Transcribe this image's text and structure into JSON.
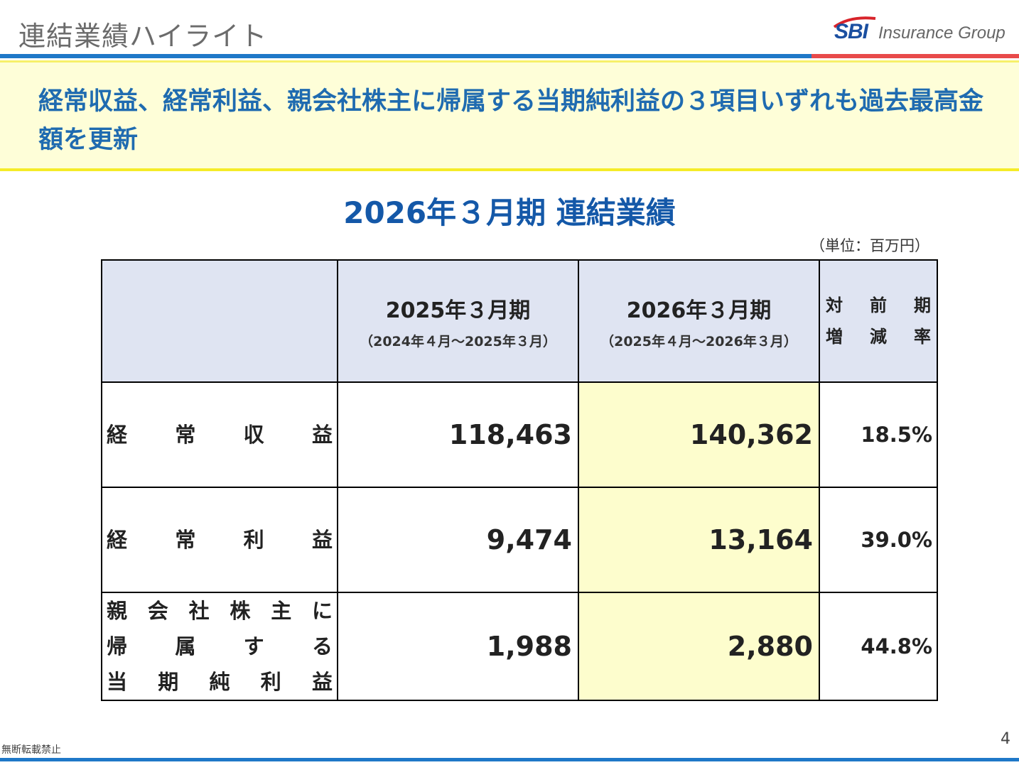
{
  "header": {
    "title": "連結業績ハイライト",
    "logo_brand": "SBI",
    "logo_group": "Insurance Group"
  },
  "banner": {
    "text": "経常収益、経常利益、親会社株主に帰属する当期純利益の３項目いずれも過去最高金額を更新"
  },
  "table": {
    "title": "2026年３月期 連結業績",
    "unit": "（単位：百万円）",
    "columns": [
      {
        "label": "2025年３月期",
        "sub": "（2024年４月～2025年３月）"
      },
      {
        "label": "2026年３月期",
        "sub": "（2025年４月～2026年３月）"
      }
    ],
    "change_header": [
      "対",
      "前",
      "期",
      "増",
      "減",
      "率"
    ],
    "rows": [
      {
        "label": [
          "経",
          "常",
          "収",
          "益"
        ],
        "prev": "118,463",
        "curr": "140,362",
        "change": "18.5%"
      },
      {
        "label": [
          "経",
          "常",
          "利",
          "益"
        ],
        "prev": "9,474",
        "curr": "13,164",
        "change": "39.0%"
      },
      {
        "label": [
          "親",
          "会",
          "社",
          "株",
          "主",
          "に",
          "帰",
          "属",
          "す",
          "る",
          "当",
          "期",
          "純",
          "利",
          "益"
        ],
        "prev": "1,988",
        "curr": "2,880",
        "change": "44.8%"
      }
    ]
  },
  "footer": {
    "note": "無断転載禁止",
    "page": "4"
  },
  "colors": {
    "accent_blue": "#1f78c8",
    "accent_red": "#e84a4a",
    "banner_bg": "#fefed8",
    "highlight": "#fdfdcd",
    "header_bg": "#dfe4f2"
  }
}
